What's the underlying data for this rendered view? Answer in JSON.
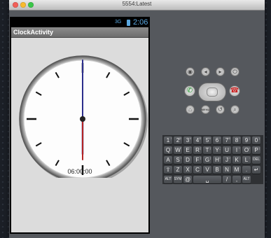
{
  "window": {
    "title": "5554:Latest"
  },
  "status_bar": {
    "signal": "3G",
    "time": "2:06"
  },
  "app": {
    "title": "ClockActivity",
    "time_display": "06:00:00"
  },
  "clock": {
    "hour": 6,
    "minute": 0,
    "second": 0
  },
  "colors": {
    "minute_hand": "#2c2e8c",
    "second_hand": "#b52424",
    "status_accent": "#5aa7e0"
  },
  "controls": {
    "row1": [
      "camera-icon",
      "volume-down-icon",
      "volume-up-icon",
      "power-icon"
    ],
    "row2": [
      "call-icon",
      "dpad",
      "end-call-icon"
    ],
    "row3": [
      "home-icon",
      "menu-icon",
      "back-icon",
      "search-icon"
    ],
    "menu_label": "MENU",
    "call_glyph": "✆",
    "end_call_glyph": "☎",
    "home_glyph": "⌂",
    "back_glyph": "↺",
    "search_glyph": "⌕",
    "camera_glyph": "◉",
    "vol_down_glyph": "◂",
    "vol_up_glyph": "▸",
    "power_glyph": "⏻"
  },
  "keyboard": {
    "row1": [
      [
        "1",
        "!"
      ],
      [
        "2",
        "@"
      ],
      [
        "3",
        "#"
      ],
      [
        "4",
        "$"
      ],
      [
        "5",
        "%"
      ],
      [
        "6",
        "^"
      ],
      [
        "7",
        "&"
      ],
      [
        "8",
        "*"
      ],
      [
        "9",
        "("
      ],
      [
        "0",
        ")"
      ]
    ],
    "row2": [
      [
        "Q",
        "~"
      ],
      [
        "W",
        "\""
      ],
      [
        "E",
        "`"
      ],
      [
        "R",
        "{"
      ],
      [
        "T",
        "}"
      ],
      [
        "Y",
        "_"
      ],
      [
        "U",
        "-"
      ],
      [
        "I",
        "+"
      ],
      [
        "O",
        "="
      ],
      [
        "P",
        "|"
      ]
    ],
    "row3": [
      [
        "A",
        ""
      ],
      [
        "S",
        "\\"
      ],
      [
        "D",
        ""
      ],
      [
        "F",
        "["
      ],
      [
        "G",
        "]"
      ],
      [
        "H",
        "<"
      ],
      [
        "J",
        ">"
      ],
      [
        "K",
        ";"
      ],
      [
        "L",
        ":"
      ],
      [
        "DEL",
        ""
      ]
    ],
    "row4": [
      [
        "⇧",
        ""
      ],
      [
        "Z",
        ""
      ],
      [
        "X",
        ""
      ],
      [
        "C",
        ""
      ],
      [
        "V",
        ""
      ],
      [
        "B",
        ""
      ],
      [
        "N",
        ""
      ],
      [
        "M",
        ""
      ],
      [
        ".",
        ""
      ],
      [
        "↵",
        ""
      ]
    ],
    "row5": [
      [
        "ALT",
        ""
      ],
      [
        "SYM",
        ""
      ],
      [
        "@",
        ""
      ],
      [
        "␣",
        ""
      ],
      [
        "/",
        ""
      ],
      [
        ",",
        ""
      ],
      [
        "ALT",
        ""
      ]
    ]
  }
}
